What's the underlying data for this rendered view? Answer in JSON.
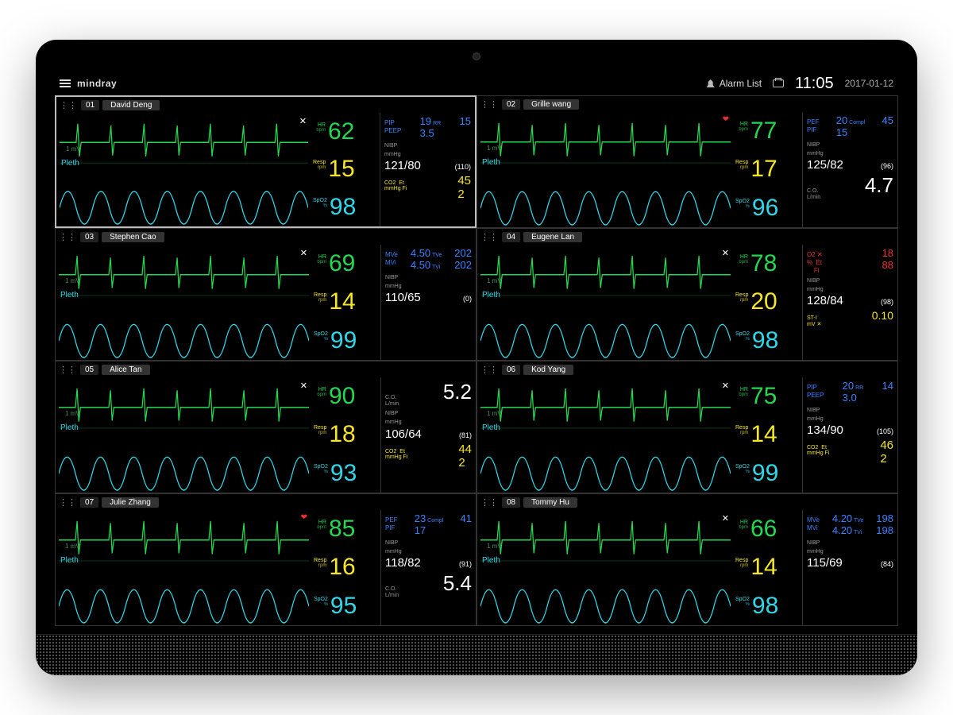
{
  "header": {
    "brand": "mindray",
    "alarm_list": "Alarm List",
    "time": "11:05",
    "date": "2017-01-12"
  },
  "labels": {
    "hr": "HR",
    "bpm": "bpm",
    "resp": "Resp",
    "rpm": "rpm",
    "spo2": "SpO2",
    "pct": "%",
    "pleth": "Pleth",
    "ecg_scale": "1 mV",
    "nibp": "NIBP",
    "mmhg": "mmHg",
    "co2": "CO2",
    "et": "Et",
    "fi": "Fi",
    "co": "C.O.",
    "lmin": "L/min",
    "pip": "PIP",
    "peep": "PEEP",
    "rr": "RR",
    "pef": "PEF",
    "pif": "PIF",
    "compl": "Compl",
    "mve": "MVe",
    "mvi": "MVi",
    "tve": "TVe",
    "tvi": "TVi",
    "o2": "O2",
    "sti": "ST-I",
    "mV": "mV"
  },
  "beds": [
    {
      "bed_id": "01",
      "name": "David Deng",
      "selected": true,
      "status_icon": "x",
      "hr": "62",
      "resp": "15",
      "spo2": "98",
      "sec_type": "pip_co2",
      "pip": "19",
      "peep": "3.5",
      "rr": "15",
      "nibp_sys": "121",
      "nibp_dia": "80",
      "nibp_mean": "(110)",
      "co2_et": "45",
      "co2_fi": "2"
    },
    {
      "bed_id": "02",
      "name": "Grille wang",
      "selected": false,
      "status_icon": "heart",
      "hr": "77",
      "resp": "17",
      "spo2": "96",
      "sec_type": "pef_co",
      "pef": "20",
      "pif": "15",
      "compl": "45",
      "nibp_sys": "125",
      "nibp_dia": "82",
      "nibp_mean": "(96)",
      "co_val": "4.7"
    },
    {
      "bed_id": "03",
      "name": "Stephen Cao",
      "selected": false,
      "status_icon": "x",
      "hr": "69",
      "resp": "14",
      "spo2": "99",
      "sec_type": "mve",
      "mve": "4.50",
      "mvi": "4.50",
      "tve": "202",
      "tvi": "202",
      "nibp_sys": "110",
      "nibp_dia": "65",
      "nibp_mean": "(0)"
    },
    {
      "bed_id": "04",
      "name": "Eugene Lan",
      "selected": false,
      "status_icon": "x",
      "hr": "78",
      "resp": "20",
      "spo2": "98",
      "sec_type": "o2_st",
      "o2_et": "18",
      "o2_fi": "88",
      "nibp_sys": "128",
      "nibp_dia": "84",
      "nibp_mean": "(98)",
      "st_val": "0.10"
    },
    {
      "bed_id": "05",
      "name": "Alice Tan",
      "selected": false,
      "status_icon": "x",
      "hr": "90",
      "resp": "18",
      "spo2": "93",
      "sec_type": "co_co2",
      "co_val": "5.2",
      "nibp_sys": "106",
      "nibp_dia": "64",
      "nibp_mean": "(81)",
      "co2_et": "44",
      "co2_fi": "2"
    },
    {
      "bed_id": "06",
      "name": "Kod Yang",
      "selected": false,
      "status_icon": "x",
      "hr": "75",
      "resp": "14",
      "spo2": "99",
      "sec_type": "pip_co2",
      "pip": "20",
      "peep": "3.0",
      "rr": "14",
      "nibp_sys": "134",
      "nibp_dia": "90",
      "nibp_mean": "(105)",
      "co2_et": "46",
      "co2_fi": "2"
    },
    {
      "bed_id": "07",
      "name": "Julie Zhang",
      "selected": false,
      "status_icon": "heart",
      "hr": "85",
      "resp": "16",
      "spo2": "95",
      "sec_type": "pef_co_full",
      "pef": "23",
      "pif": "17",
      "compl": "41",
      "nibp_sys": "118",
      "nibp_dia": "82",
      "nibp_mean": "(91)",
      "co_val": "5.4"
    },
    {
      "bed_id": "08",
      "name": "Tommy Hu",
      "selected": false,
      "status_icon": "x",
      "hr": "66",
      "resp": "14",
      "spo2": "98",
      "sec_type": "mve",
      "mve": "4.20",
      "mvi": "4.20",
      "tve": "198",
      "tvi": "198",
      "nibp_sys": "115",
      "nibp_dia": "69",
      "nibp_mean": "(84)"
    }
  ]
}
